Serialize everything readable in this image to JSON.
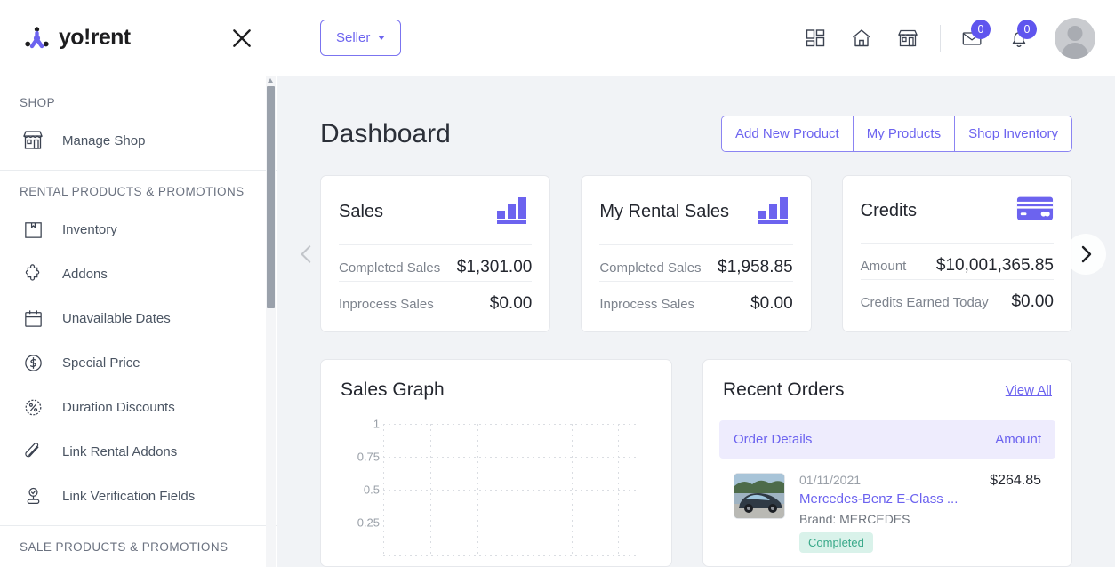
{
  "brand": {
    "name": "yo!rent",
    "accent": "#5f55ee"
  },
  "sidebar": {
    "close_icon": "close-icon",
    "sections": [
      {
        "title": "SHOP",
        "items": [
          {
            "label": "Manage Shop",
            "icon": "shop-icon"
          }
        ]
      },
      {
        "title": "RENTAL PRODUCTS & PROMOTIONS",
        "items": [
          {
            "label": "Inventory",
            "icon": "box-icon"
          },
          {
            "label": "Addons",
            "icon": "puzzle-icon"
          },
          {
            "label": "Unavailable Dates",
            "icon": "calendar-icon"
          },
          {
            "label": "Special Price",
            "icon": "dollar-circle-icon"
          },
          {
            "label": "Duration Discounts",
            "icon": "percent-badge-icon"
          },
          {
            "label": "Link Rental Addons",
            "icon": "paperclip-icon"
          },
          {
            "label": "Link Verification Fields",
            "icon": "verified-stamp-icon"
          }
        ]
      },
      {
        "title": "SALE PRODUCTS & PROMOTIONS",
        "items": []
      }
    ]
  },
  "topbar": {
    "seller_label": "Seller",
    "icons": [
      {
        "name": "layout-dashboard-icon",
        "badge": null
      },
      {
        "name": "home-icon",
        "badge": null
      },
      {
        "name": "storefront-icon",
        "badge": null
      },
      {
        "name": "mail-icon",
        "badge": "0"
      },
      {
        "name": "bell-icon",
        "badge": "0"
      }
    ],
    "avatar": "user-avatar"
  },
  "page": {
    "title": "Dashboard",
    "actions": [
      "Add New Product",
      "My Products",
      "Shop Inventory"
    ]
  },
  "stat_cards": [
    {
      "title": "Sales",
      "icon": "bar-chart-icon",
      "rows": [
        {
          "label": "Completed Sales",
          "value": "$1,301.00"
        },
        {
          "label": "Inprocess Sales",
          "value": "$0.00"
        }
      ]
    },
    {
      "title": "My Rental Sales",
      "icon": "bar-chart-icon",
      "rows": [
        {
          "label": "Completed Sales",
          "value": "$1,958.85"
        },
        {
          "label": "Inprocess Sales",
          "value": "$0.00"
        }
      ]
    },
    {
      "title": "Credits",
      "icon": "credit-card-icon",
      "rows": [
        {
          "label": "Amount",
          "value": "$10,001,365.85"
        },
        {
          "label": "Credits Earned Today",
          "value": "$0.00"
        }
      ]
    }
  ],
  "carousel": {
    "prev": "chevron-left-icon",
    "next": "chevron-right-icon"
  },
  "sales_graph": {
    "title": "Sales Graph"
  },
  "chart_data": {
    "type": "line",
    "title": "Sales Graph",
    "x": [],
    "values": [],
    "series": [],
    "xlabel": "",
    "ylabel": "",
    "ylim": [
      0,
      1
    ],
    "yticks": [
      "1",
      "0.75",
      "0.5",
      "0.25"
    ],
    "grid": true,
    "legend": "none",
    "empty": true
  },
  "recent_orders": {
    "title": "Recent Orders",
    "view_all": "View All",
    "columns": {
      "details": "Order Details",
      "amount": "Amount"
    },
    "rows": [
      {
        "date": "01/11/2021",
        "name": "Mercedes-Benz E-Class ...",
        "brand": "Brand: MERCEDES",
        "status": "Completed",
        "amount": "$264.85",
        "thumb": "car-thumbnail"
      }
    ]
  }
}
